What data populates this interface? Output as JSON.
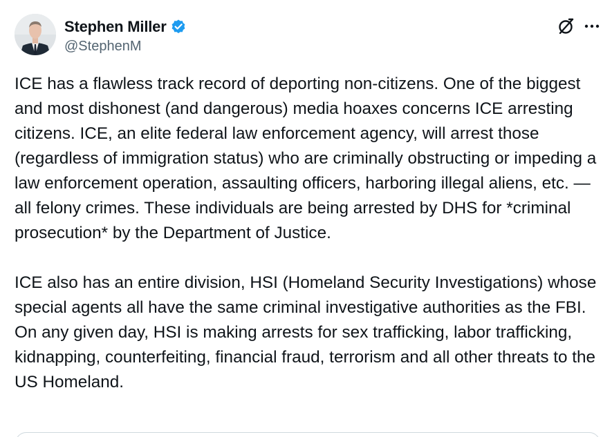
{
  "author": {
    "display_name": "Stephen Miller",
    "handle": "@StephenM",
    "verified": true,
    "verified_color": "#1d9bf0",
    "avatar_icon": "avatar-photo"
  },
  "actions": {
    "grok_icon": "grok-icon",
    "more_icon": "more-options-icon"
  },
  "tweet": {
    "paragraph_1": "ICE has a flawless track record of deporting non-citizens. One of the biggest and most dishonest (and dangerous) media hoaxes concerns ICE arresting citizens. ICE, an elite federal law enforcement agency, will arrest those (regardless of immigration status) who are criminally obstructing or impeding a law enforcement operation, assaulting officers, harboring illegal aliens, etc. — all felony crimes. These individuals are being arrested by DHS for *criminal prosecution* by the Department of Justice.",
    "paragraph_2": "ICE also has an entire division, HSI (Homeland Security Investigations) whose special agents all have the same criminal investigative authorities as the FBI. On any given day, HSI is making arrests for sex trafficking, labor trafficking, kidnapping, counterfeiting, financial fraud, terrorism and all other threats to the US Homeland."
  },
  "colors": {
    "text": "#0f1419",
    "secondary": "#536471",
    "border": "#cfd9de"
  }
}
